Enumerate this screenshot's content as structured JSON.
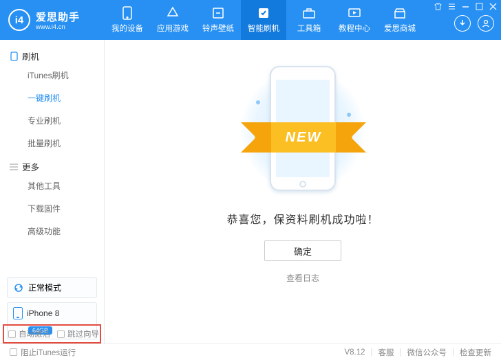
{
  "brand": {
    "logo_text": "i4",
    "title": "爱思助手",
    "subtitle": "www.i4.cn"
  },
  "nav": {
    "items": [
      {
        "label": "我的设备",
        "icon": "phone-icon"
      },
      {
        "label": "应用游戏",
        "icon": "apps-icon"
      },
      {
        "label": "铃声壁纸",
        "icon": "note-icon"
      },
      {
        "label": "智能刷机",
        "icon": "flash-icon"
      },
      {
        "label": "工具箱",
        "icon": "toolbox-icon"
      },
      {
        "label": "教程中心",
        "icon": "tutorial-icon"
      },
      {
        "label": "爱思商城",
        "icon": "store-icon"
      }
    ],
    "active_index": 3
  },
  "sidebar": {
    "section1": {
      "title": "刷机",
      "items": [
        "iTunes刷机",
        "一键刷机",
        "专业刷机",
        "批量刷机"
      ],
      "active_index": 1
    },
    "section2": {
      "title": "更多",
      "items": [
        "其他工具",
        "下载固件",
        "高级功能"
      ]
    },
    "mode_label": "正常模式",
    "device": {
      "name": "iPhone 8",
      "badge": "64GB"
    },
    "checkboxes": {
      "auto_activate": "自动激活",
      "skip_guide": "跳过向导"
    }
  },
  "main": {
    "ribbon": "NEW",
    "success": "恭喜您，保资料刷机成功啦！",
    "ok_button": "确定",
    "view_log": "查看日志"
  },
  "status": {
    "prevent_itunes": "阻止iTunes运行",
    "version": "V8.12",
    "support": "客服",
    "wechat": "微信公众号",
    "update": "检查更新"
  }
}
